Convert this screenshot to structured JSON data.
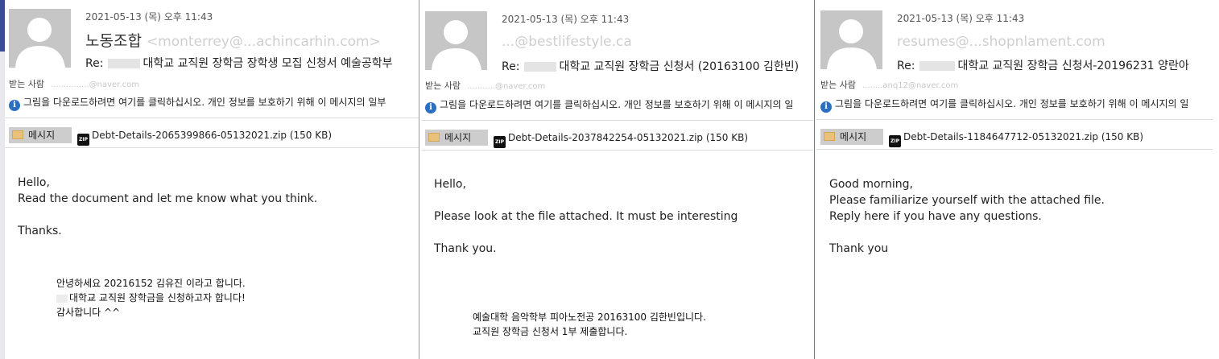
{
  "panels": [
    {
      "date": "2021-05-13 (목) 오후 11:43",
      "sender_name": "노동조합",
      "sender_address": "<monterrey@...achincarhin.com>",
      "subject_prefix": "Re:",
      "subject_text": "대학교 교직원 장학금 장학생 모집 신청서 예술공학부",
      "to_label": "받는 사람",
      "to_address": "...............@naver.com",
      "info_text": "그림을 다운로드하려면 여기를 클릭하십시오. 개인 정보를 보호하기 위해 이 메시지의 일부",
      "message_tab": "메시지",
      "attachment": "Debt-Details-2065399866-05132021.zip (150 KB)",
      "body_lines": [
        "Hello,",
        "Read the document and let me know what you think.",
        "",
        "Thanks."
      ],
      "korean_lines": [
        "안녕하세요 20216152 김유진 이라고 합니다.",
        "대학교 교직원 장학금을 신청하고자 합니다!",
        "감사합니다 ^^"
      ]
    },
    {
      "date": "2021-05-13 (목) 오후 11:43",
      "sender_name": "",
      "sender_address": "...@bestlifestyle.ca",
      "subject_prefix": "Re:",
      "subject_text": "대학교 교직원 장학금 신청서 (20163100 김한빈)",
      "to_label": "받는 사람",
      "to_address": "...........@naver.com",
      "info_text": "그림을 다운로드하려면 여기를 클릭하십시오. 개인 정보를 보호하기 위해 이 메시지의 일",
      "message_tab": "메시지",
      "attachment": "Debt-Details-2037842254-05132021.zip (150 KB)",
      "body_lines": [
        "Hello,",
        "",
        "Please look at the file attached. It must be interesting",
        "",
        "Thank you."
      ],
      "korean_lines": [
        "예술대학 음악학부 피아노전공 20163100 김한빈입니다.",
        "교직원 장학금 신청서 1부 제출합니다."
      ]
    },
    {
      "date": "2021-05-13 (목) 오후 11:43",
      "sender_name": "",
      "sender_address": "resumes@...shopnlament.com",
      "subject_prefix": "Re:",
      "subject_text": "대학교 교직원 장학금 신청서-20196231 양란아",
      "to_label": "받는 사람",
      "to_address": "........anq12@naver.com",
      "info_text": "그림을 다운로드하려면 여기를 클릭하십시오. 개인 정보를 보호하기 위해 이 메시지의 일",
      "message_tab": "메시지",
      "attachment": "Debt-Details-1184647712-05132021.zip (150 KB)",
      "body_lines": [
        "Good morning,",
        "Please familiarize yourself with the attached file.",
        "Reply here if you have any questions.",
        "",
        "Thank you"
      ],
      "korean_lines": []
    }
  ],
  "icons": {
    "avatar": "person-silhouette-icon",
    "info": "info-circle-icon",
    "message": "envelope-icon",
    "zip": "zip-file-icon"
  },
  "colors": {
    "info_icon": "#2c6fc0",
    "avatar_bg": "#c6c6c6",
    "message_tab_bg": "#cdcdcd",
    "right_separator": "#4c7ee0"
  }
}
